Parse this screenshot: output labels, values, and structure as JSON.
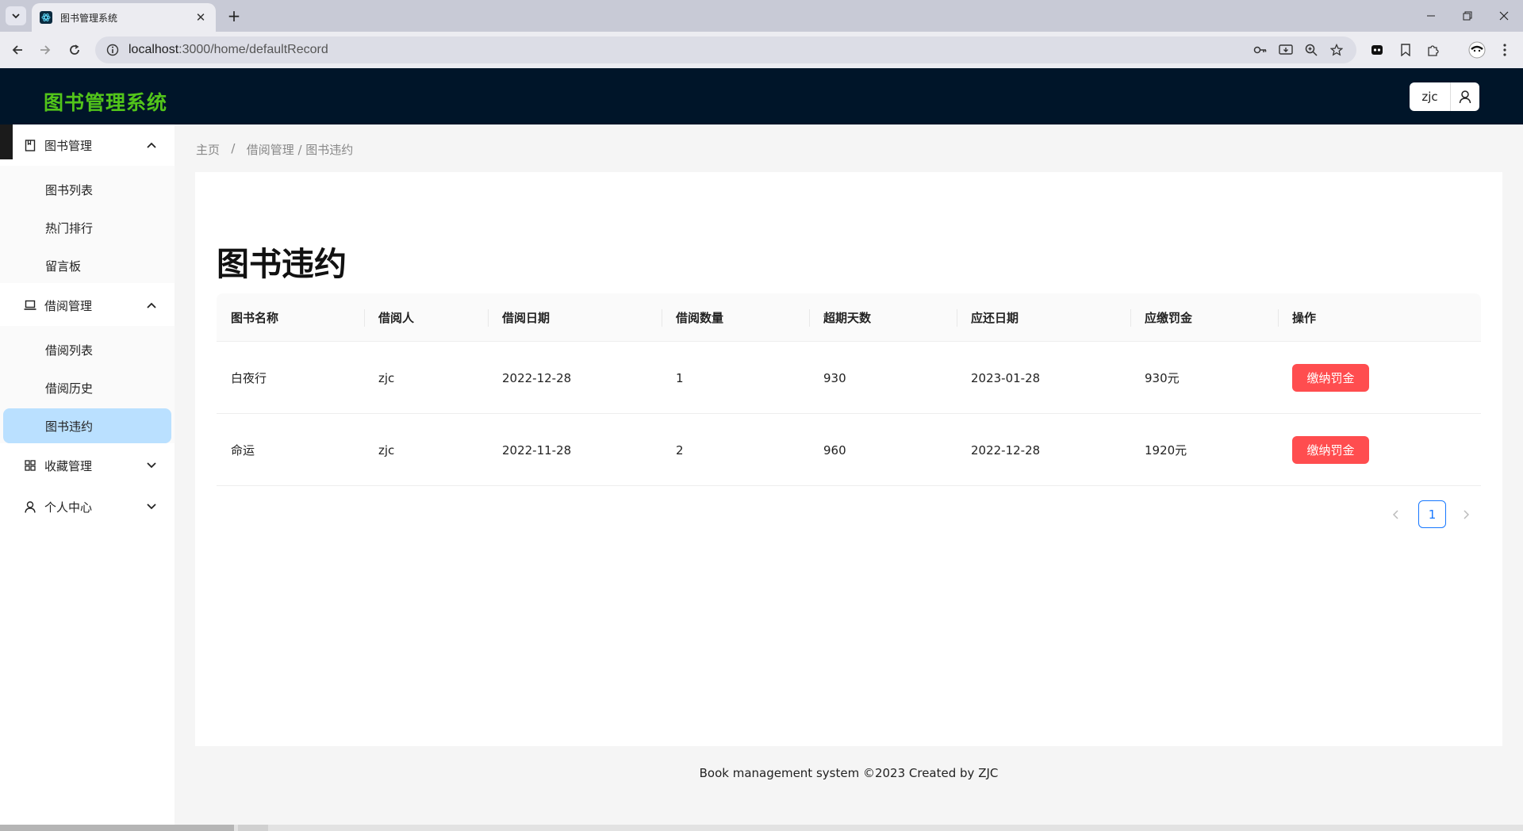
{
  "browser": {
    "tab_title": "图书管理系统",
    "url_host": "localhost",
    "url_rest": ":3000/home/defaultRecord"
  },
  "app": {
    "logo": "图书管理系统",
    "username": "zjc"
  },
  "sidebar": {
    "groups": [
      {
        "label": "图书管理",
        "icon": "book-icon",
        "expanded": true,
        "items": [
          "图书列表",
          "热门排行",
          "留言板"
        ]
      },
      {
        "label": "借阅管理",
        "icon": "laptop-icon",
        "expanded": true,
        "items": [
          "借阅列表",
          "借阅历史",
          "图书违约"
        ]
      },
      {
        "label": "收藏管理",
        "icon": "appstore-icon",
        "expanded": false,
        "items": []
      },
      {
        "label": "个人中心",
        "icon": "user-icon",
        "expanded": false,
        "items": []
      }
    ],
    "active_item": "图书违约"
  },
  "breadcrumb": {
    "home": "主页",
    "sep": "/",
    "path": "借阅管理 / 图书违约"
  },
  "page": {
    "title": "图书违约"
  },
  "table": {
    "columns": [
      "图书名称",
      "借阅人",
      "借阅日期",
      "借阅数量",
      "超期天数",
      "应还日期",
      "应缴罚金",
      "操作"
    ],
    "rows": [
      {
        "book": "白夜行",
        "borrower": "zjc",
        "borrow_date": "2022-12-28",
        "quantity": "1",
        "overdue_days": "930",
        "due_date": "2023-01-28",
        "fine": "930元",
        "action": "缴纳罚金"
      },
      {
        "book": "命运",
        "borrower": "zjc",
        "borrow_date": "2022-11-28",
        "quantity": "2",
        "overdue_days": "960",
        "due_date": "2022-12-28",
        "fine": "1920元",
        "action": "缴纳罚金"
      }
    ]
  },
  "pagination": {
    "current": "1"
  },
  "footer": {
    "text": "Book management system ©2023 Created by ZJC"
  },
  "colors": {
    "header_bg": "#001529",
    "logo": "#52c41a",
    "active_menu": "#bae0ff",
    "danger": "#ff4d4f",
    "primary": "#1677ff"
  }
}
